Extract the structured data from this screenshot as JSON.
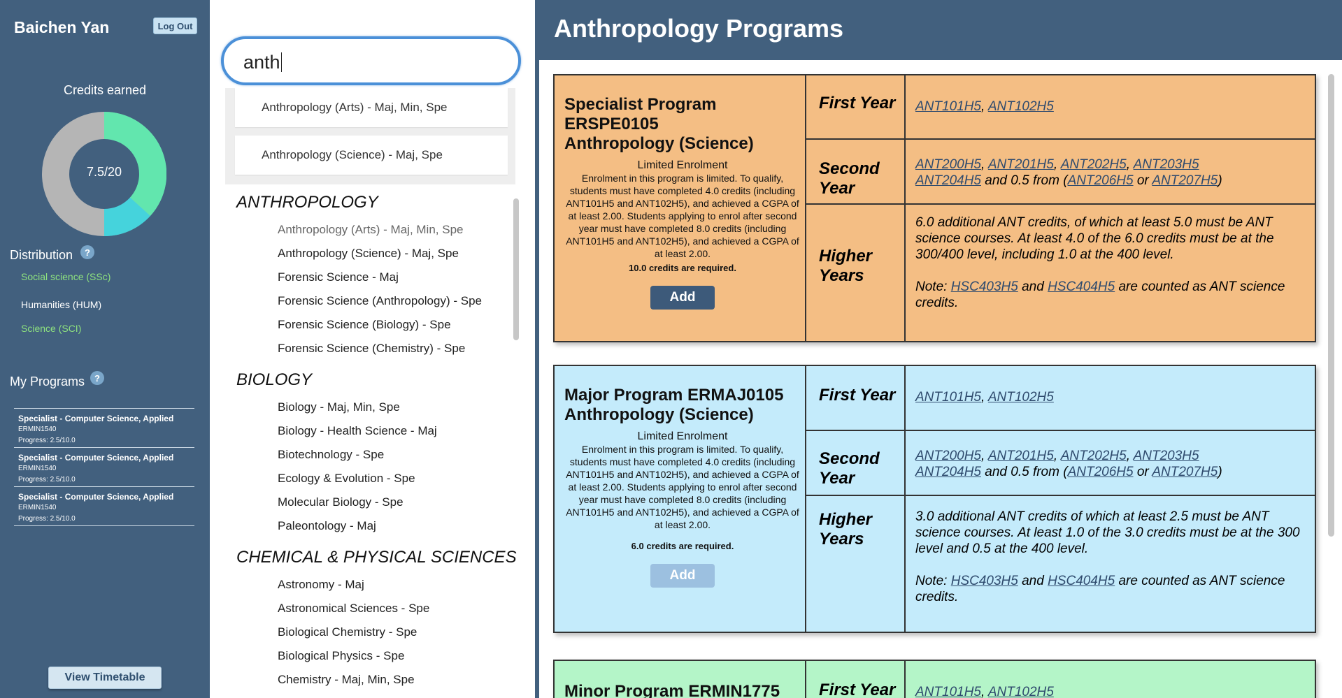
{
  "sidebar": {
    "user_name": "Baichen Yan",
    "logout_label": "Log Out",
    "credits_title": "Credits earned",
    "credits_value": "7.5/20",
    "donut_colors": {
      "base": "#b5b5b5",
      "ssc": "#62e6ae",
      "sci": "#45d3dc",
      "hole": "#42607e"
    },
    "distribution_title": "Distribution",
    "help_glyph": "?",
    "distribution": [
      {
        "label": "Social science (SSc)",
        "color": "#8ee27f"
      },
      {
        "label": "Humanities (HUM)",
        "color": "#ffffff"
      },
      {
        "label": "Science (SCI)",
        "color": "#8ee27f"
      }
    ],
    "my_programs_title": "My Programs",
    "programs": [
      {
        "name": "Specialist - Computer Science, Applied",
        "code": "ERMIN1540",
        "progress": "Progress: 2.5/10.0"
      },
      {
        "name": "Specialist - Computer Science, Applied",
        "code": "ERMIN1540",
        "progress": "Progress: 2.5/10.0"
      },
      {
        "name": "Specialist - Computer Science, Applied",
        "code": "ERMIN1540",
        "progress": "Progress: 2.5/10.0"
      }
    ],
    "timetable_label": "View Timetable"
  },
  "search": {
    "value": "anth",
    "suggestions": [
      "Anthropology (Arts) - Maj, Min, Spe",
      "Anthropology (Science) - Maj, Spe"
    ],
    "categories": [
      {
        "heading": "ANTHROPOLOGY",
        "items": [
          "Anthropology (Arts) - Maj, Min, Spe",
          "Anthropology (Science) - Maj, Spe",
          "Forensic Science - Maj",
          "Forensic Science (Anthropology) - Spe",
          "Forensic Science (Biology) - Spe",
          "Forensic Science (Chemistry) - Spe"
        ]
      },
      {
        "heading": "BIOLOGY",
        "items": [
          "Biology - Maj, Min, Spe",
          "Biology - Health Science - Maj",
          "Biotechnology - Spe",
          "Ecology & Evolution - Spe",
          "Molecular Biology - Spe",
          "Paleontology - Maj"
        ]
      },
      {
        "heading": "CHEMICAL & PHYSICAL SCIENCES",
        "items": [
          "Astronomy - Maj",
          "Astronomical Sciences - Spe",
          "Biological Chemistry - Spe",
          "Biological Physics - Spe",
          "Chemistry - Maj, Min, Spe"
        ]
      }
    ]
  },
  "main": {
    "title": "Anthropology Programs",
    "programs": [
      {
        "title_line1": "Specialist Program ERSPE0105",
        "title_line2": "Anthropology (Science)",
        "enrolment": "Limited Enrolment",
        "description": "Enrolment in this program is limited. To qualify, students must have completed 4.0 credits (including ANT101H5 and ANT102H5), and achieved a CGPA of at least 2.00. Students applying to enrol after second year must have completed 8.0 credits (including ANT101H5 and ANT102H5), and achieved a CGPA of at least 2.00.",
        "credits_required": "10.0 credits are required.",
        "add_label": "Add",
        "bg_color": "#f4be84",
        "button_color": "#3d5a7a",
        "years": {
          "first_label": "First Year",
          "first": {
            "c1": "ANT101H5",
            "c2": "ANT102H5"
          },
          "second_label_1": "Second",
          "second_label_2": "Year",
          "second": {
            "c1": "ANT200H5",
            "c2": "ANT201H5",
            "c3": "ANT202H5",
            "c4": "ANT203H5",
            "c5": "ANT204H5",
            "c6": "ANT206H5",
            "c7": "ANT207H5",
            "mid": "and 0.5 from",
            "or": "or"
          },
          "higher_label_1": "Higher",
          "higher_label_2": "Years",
          "higher_text": "6.0 additional ANT credits, of which at least 5.0 must be ANT science courses. At least 4.0 of the 6.0 credits must be at the 300/400 level, including 1.0 at the 400 level.",
          "note_prefix": "Note:",
          "note_c1": "HSC403H5",
          "note_and": "and",
          "note_c2": "HSC404H5",
          "note_suffix": "are counted as ANT science credits."
        }
      },
      {
        "title_line1": "Major Program ERMAJ0105",
        "title_line2": "Anthropology (Science)",
        "enrolment": "Limited Enrolment",
        "description": "Enrolment in this program is limited. To qualify, students must have completed 4.0 credits (including ANT101H5 and ANT102H5), and achieved a CGPA of at least 2.00. Students applying to enrol after second year must have completed 8.0 credits (including ANT101H5 and ANT102H5), and achieved a CGPA of at least 2.00.",
        "credits_required": "6.0 credits are required.",
        "add_label": "Add",
        "bg_color": "#c4ebfb",
        "button_color": "#9cc0e0",
        "years": {
          "first_label": "First Year",
          "first": {
            "c1": "ANT101H5",
            "c2": "ANT102H5"
          },
          "second_label_1": "Second",
          "second_label_2": "Year",
          "second": {
            "c1": "ANT200H5",
            "c2": "ANT201H5",
            "c3": "ANT202H5",
            "c4": "ANT203H5",
            "c5": "ANT204H5",
            "c6": "ANT206H5",
            "c7": "ANT207H5",
            "mid": "and 0.5 from",
            "or": "or"
          },
          "higher_label_1": "Higher",
          "higher_label_2": "Years",
          "higher_text": "3.0 additional ANT credits of which at least 2.5 must be ANT science courses. At least 1.0 of the 3.0 credits must be at the 300 level and 0.5 at the 400 level.",
          "note_prefix": "Note:",
          "note_c1": "HSC403H5",
          "note_and": "and",
          "note_c2": "HSC404H5",
          "note_suffix": "are counted as ANT science credits."
        }
      },
      {
        "title_line1": "Minor Program ERMIN1775",
        "bg_color": "#b4f5c8",
        "years": {
          "first_label": "First Year",
          "first": {
            "c1": "ANT101H5",
            "c2": "ANT102H5"
          }
        }
      }
    ]
  }
}
